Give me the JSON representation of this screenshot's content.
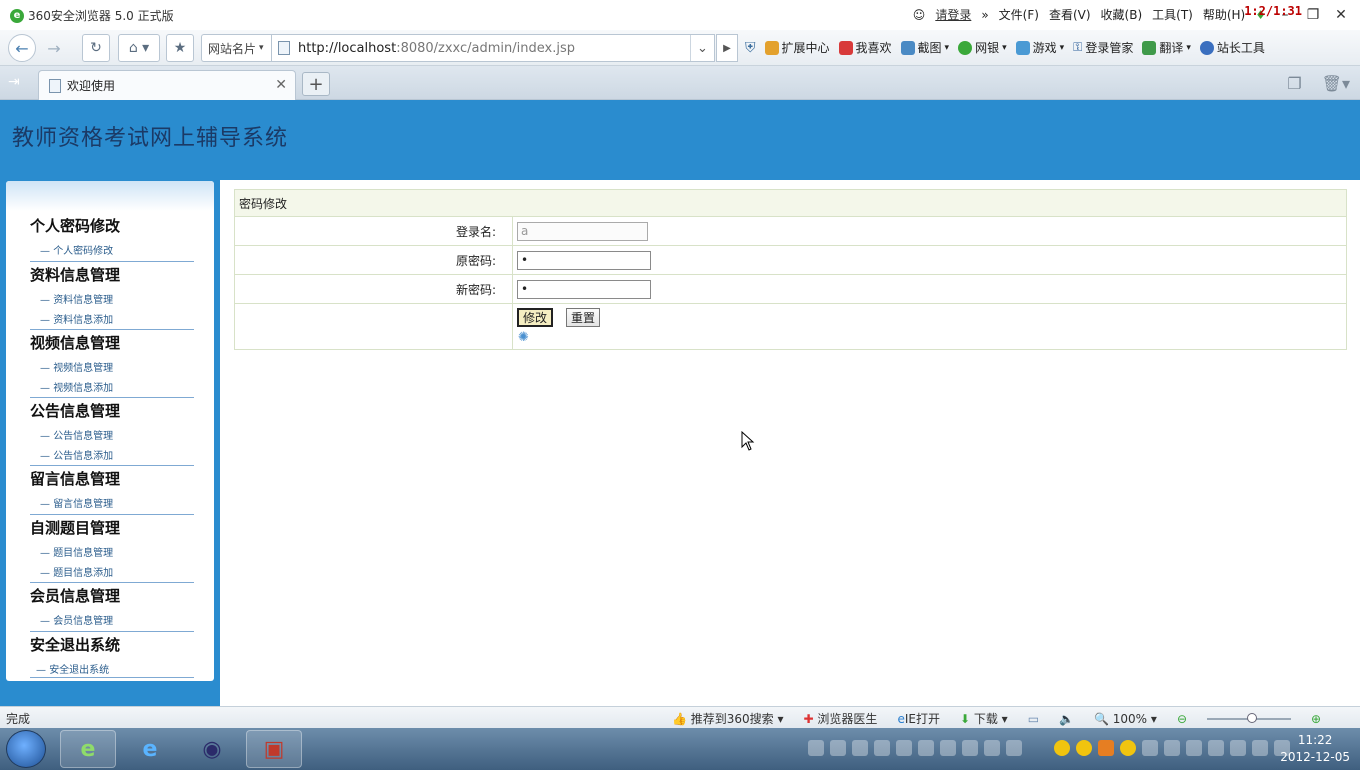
{
  "browser": {
    "window_title": "360安全浏览器 5.0 正式版",
    "login_link": "请登录",
    "menus": [
      "文件(F)",
      "查看(V)",
      "收藏(B)",
      "工具(T)",
      "帮助(H)"
    ],
    "overlay_text": "1:2/1:31",
    "site_card_label": "网站名片",
    "url_host": "http://localhost",
    "url_rest": ":8080/zxxc/admin/index.jsp",
    "toolbar": [
      "扩展中心",
      "我喜欢",
      "截图",
      "网银",
      "游戏",
      "登录管家",
      "翻译",
      "站长工具"
    ],
    "tab_title": "欢迎使用",
    "status_left": "完成",
    "status_items": [
      "推荐到360搜索",
      "浏览器医生",
      "IE打开",
      "下载"
    ],
    "zoom": "100%",
    "clock_time": "11:22",
    "clock_date": "2012-12-05"
  },
  "page": {
    "system_name": "教师资格考试网上辅导系统",
    "menu": [
      {
        "title": "个人密码修改",
        "items": [
          "个人密码修改"
        ]
      },
      {
        "title": "资料信息管理",
        "items": [
          "资料信息管理",
          "资料信息添加"
        ]
      },
      {
        "title": "视频信息管理",
        "items": [
          "视频信息管理",
          "视频信息添加"
        ]
      },
      {
        "title": "公告信息管理",
        "items": [
          "公告信息管理",
          "公告信息添加"
        ]
      },
      {
        "title": "留言信息管理",
        "items": [
          "留言信息管理"
        ]
      },
      {
        "title": "自测题目管理",
        "items": [
          "题目信息管理",
          "题目信息添加"
        ]
      },
      {
        "title": "会员信息管理",
        "items": [
          "会员信息管理"
        ]
      },
      {
        "title": "安全退出系统",
        "items": [
          "安全退出系统"
        ]
      }
    ],
    "form": {
      "header": "密码修改",
      "login_label": "登录名:",
      "login_value": "a",
      "old_pw_label": "原密码:",
      "old_pw_value": "•",
      "new_pw_label": "新密码:",
      "new_pw_value": "•",
      "submit_label": "修改",
      "reset_label": "重置"
    }
  },
  "colors": {
    "header_blue": "#2a8ccf",
    "title_navy": "#1b3a66",
    "form_border": "#d8e2c8",
    "form_header_bg": "#f4f7ea"
  }
}
